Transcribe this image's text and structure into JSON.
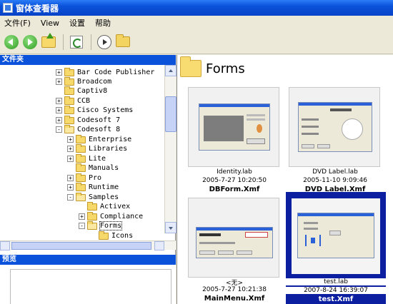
{
  "window": {
    "title": "窗体查看器"
  },
  "menu": [
    "文件(F)",
    "View",
    "设置",
    "帮助"
  ],
  "toolbar": {
    "buttons": [
      {
        "name": "back",
        "icon": "back-arrow-icon"
      },
      {
        "name": "forward",
        "icon": "forward-arrow-icon"
      },
      {
        "name": "up-folder",
        "icon": "up-folder-icon"
      },
      {
        "name": "refresh",
        "icon": "refresh-icon"
      },
      {
        "name": "play",
        "icon": "play-icon"
      },
      {
        "name": "open-folder",
        "icon": "folder-open-icon"
      }
    ]
  },
  "folders_panel": {
    "header": "文件夹"
  },
  "tree": [
    {
      "label": "Bar Code Publisher",
      "expander": "+"
    },
    {
      "label": "Broadcom",
      "expander": "+"
    },
    {
      "label": "Captiv8",
      "expander": ""
    },
    {
      "label": "CCB",
      "expander": "+"
    },
    {
      "label": "Cisco Systems",
      "expander": "+"
    },
    {
      "label": "Codesoft 7",
      "expander": "+"
    },
    {
      "label": "Codesoft 8",
      "expander": "-"
    },
    {
      "label": "Enterprise",
      "expander": "+"
    },
    {
      "label": "Libraries",
      "expander": "+"
    },
    {
      "label": "Lite",
      "expander": "+"
    },
    {
      "label": "Manuals",
      "expander": ""
    },
    {
      "label": "Pro",
      "expander": "+"
    },
    {
      "label": "Runtime",
      "expander": "+"
    },
    {
      "label": "Samples",
      "expander": "-"
    },
    {
      "label": "Activex",
      "expander": ""
    },
    {
      "label": "Compliance",
      "expander": "+"
    },
    {
      "label": "Forms",
      "expander": "-"
    },
    {
      "label": "Icons",
      "expander": ""
    }
  ],
  "preview_panel": {
    "header": "预览"
  },
  "content": {
    "folder_title": "Forms",
    "items": [
      {
        "file": "Identity.lab",
        "date": "2005-7-27 10:20:50",
        "name": "DBForm.Xmf",
        "selected": false
      },
      {
        "file": "DVD Label.lab",
        "date": "2005-11-10 9:09:46",
        "name": "DVD Label.Xmf",
        "selected": false
      },
      {
        "file": "<无>",
        "date": "2005-7-27 10:21:38",
        "name": "MainMenu.Xmf",
        "selected": false
      },
      {
        "file": "test.lab",
        "date": "2007-8-24 16:39:07",
        "name": "test.Xmf",
        "selected": true
      }
    ]
  },
  "colors": {
    "titlebar": "#0a52d9",
    "selection": "#0b1fa0",
    "folder": "#f6d86b"
  }
}
